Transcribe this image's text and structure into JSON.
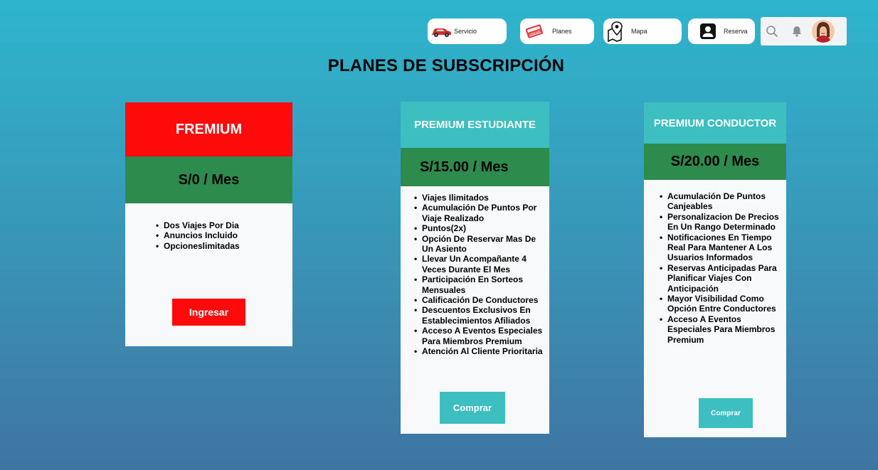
{
  "nav": {
    "items": [
      {
        "label": "Servicio",
        "icon": "car-icon"
      },
      {
        "label": "Planes",
        "icon": "ticket-icon"
      },
      {
        "label": "Mapa",
        "icon": "map-pin-icon"
      },
      {
        "label": "Reserva",
        "icon": "account-icon"
      }
    ],
    "planes_badge": "Upgrade"
  },
  "utility": {
    "search_icon": "search-icon",
    "bell_icon": "bell-icon",
    "avatar": "user-avatar"
  },
  "title": "PLANES DE SUBSCRIPCIÓN",
  "plans": [
    {
      "name": "FREMIUM",
      "price": "S/0 / Mes",
      "features": [
        "Dos Viajes Por Dia",
        "Anuncios Incluido",
        "Opcioneslimitadas"
      ],
      "cta": "Ingresar"
    },
    {
      "name": "PREMIUM ESTUDIANTE",
      "price": "S/15.00 / Mes",
      "features": [
        "Viajes Ilimitados",
        "Acumulación De Puntos Por Viaje Realizado",
        "Puntos(2x)",
        "Opción De Reservar Mas De Un Asiento",
        "Llevar Un Acompañante 4 Veces Durante El Mes",
        "Participación En Sorteos Mensuales",
        "Calificación De Conductores",
        "Descuentos Exclusivos En Establecimientos Afiliados",
        "Acceso A Eventos Especiales Para Miembros Premium",
        "Atención Al Cliente Prioritaria"
      ],
      "cta": "Comprar"
    },
    {
      "name": "PREMIUM CONDUCTOR",
      "price": "S/20.00 / Mes",
      "features": [
        "Acumulación De Puntos Canjeables",
        "Personalizacion De Precios En Un Rango Determinado",
        "Notificaciones En Tiempo Real Para Mantener A Los Usuarios Informados",
        "Reservas Anticipadas Para Planificar Viajes Con Anticipación",
        "Mayor Visibilidad Como Opción Entre Conductores",
        "Acceso A Eventos Especiales Para Miembros Premium"
      ],
      "cta": "Comprar"
    }
  ],
  "colors": {
    "background_top": "#2eb5cd",
    "background_bottom": "#3f74a2",
    "red": "#ff0a0a",
    "green": "#2e8b4e",
    "teal": "#3dbfc1"
  }
}
